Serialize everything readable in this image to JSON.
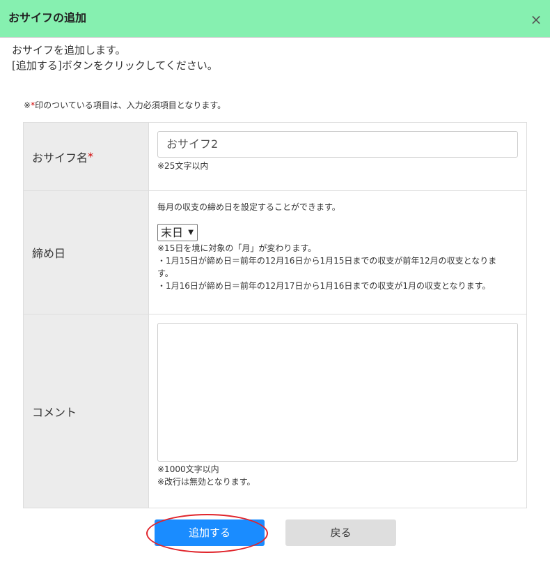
{
  "header": {
    "title": "おサイフの追加",
    "close_label": "×",
    "background": "#86f0b0"
  },
  "intro": {
    "line1": "おサイフを追加します。",
    "line2": "[追加する]ボタンをクリックしてください。"
  },
  "required_note": {
    "prefix": "※",
    "star": "*",
    "text": "印のついている項目は、入力必須項目となります。"
  },
  "form": {
    "name": {
      "label": "おサイフ名",
      "required_mark": "*",
      "value": "おサイフ2",
      "hint": "※25文字以内"
    },
    "closing": {
      "label": "締め日",
      "description": "毎月の収支の締め日を設定することができます。",
      "selected": "末日",
      "notes": [
        "※15日を境に対象の「月」が変わります。",
        "・1月15日が締め日＝前年の12月16日から1月15日までの収支が前年12月の収支となりま",
        "す。",
        "・1月16日が締め日＝前年の12月17日から1月16日までの収支が1月の収支となります。"
      ]
    },
    "comment": {
      "label": "コメント",
      "value": "",
      "hints": [
        "※1000文字以内",
        "※改行は無効となります。"
      ]
    }
  },
  "buttons": {
    "add_label": "追加する",
    "back_label": "戻る",
    "add_color": "#1a8cff",
    "highlight_color": "#e0242b"
  }
}
